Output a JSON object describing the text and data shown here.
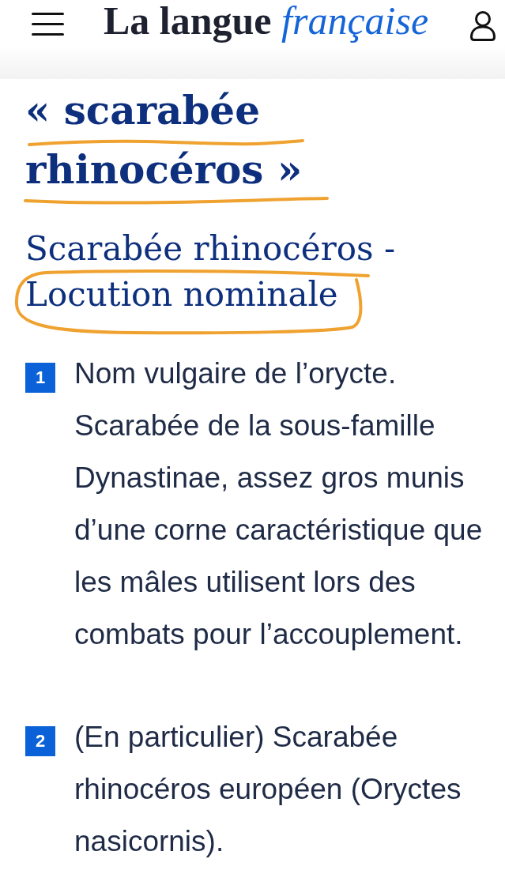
{
  "header": {
    "logo": {
      "main": "La langue",
      "accent": "française"
    }
  },
  "entry": {
    "title": {
      "text": "« scarabée rhinocéros »",
      "underlined": true
    },
    "subtitle": {
      "text": "Scarabée rhinocéros -",
      "category": "Locution nominale",
      "category_circled": true
    }
  },
  "definitions": [
    {
      "number": "1",
      "text": "Nom vulgaire de l’orycte. Scarabée de la sous-famille Dynastinae, assez gros munis d’une corne caractéristique que les mâles utilisent lors des combats pour l’accouplement."
    },
    {
      "number": "2",
      "text": "(En particulier) Scarabée rhinocéros européen (Oryctes nasicornis)."
    }
  ]
}
